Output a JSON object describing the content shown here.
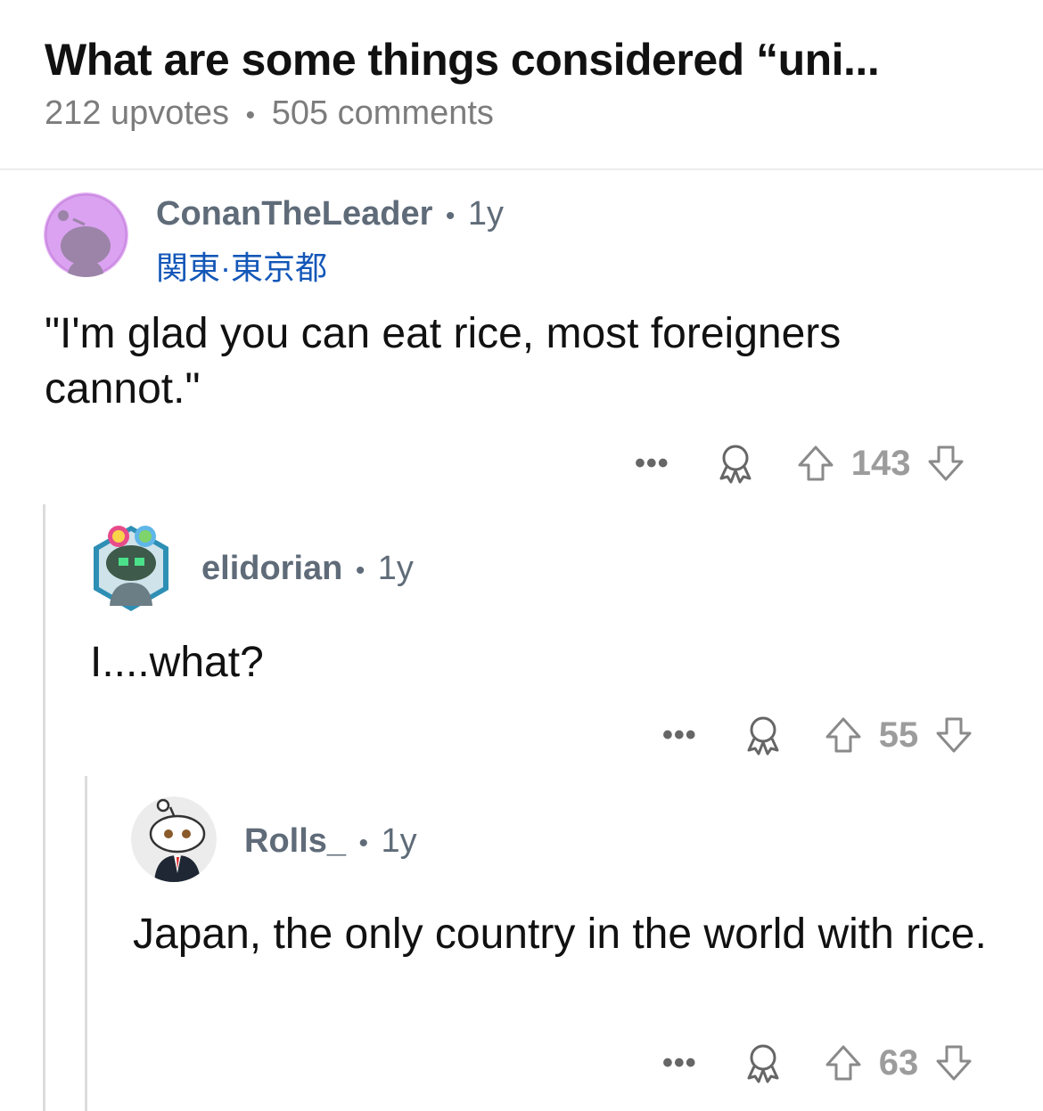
{
  "post": {
    "title": "What are some things considered “uni...",
    "upvotes": "212 upvotes",
    "comments": "505 comments",
    "separator": "•"
  },
  "comments": [
    {
      "username": "ConanTheLeader",
      "age": "1y",
      "flair": "関東·東京都",
      "body": "\"I'm glad you can eat rice, most foreigners cannot.\"",
      "score": "143"
    },
    {
      "username": "elidorian",
      "age": "1y",
      "body": "I....what?",
      "score": "55"
    },
    {
      "username": "Rolls_",
      "age": "1y",
      "body": "Japan, the only country in the world with rice.",
      "score": "63"
    }
  ],
  "icons": {
    "more": "more-options-icon",
    "award": "award-icon",
    "upvote": "upvote-icon",
    "downvote": "downvote-icon"
  },
  "colors": {
    "username": "#5f6b78",
    "flair": "#1457b8",
    "meta": "#7c7c7c"
  },
  "more_label": "•••"
}
